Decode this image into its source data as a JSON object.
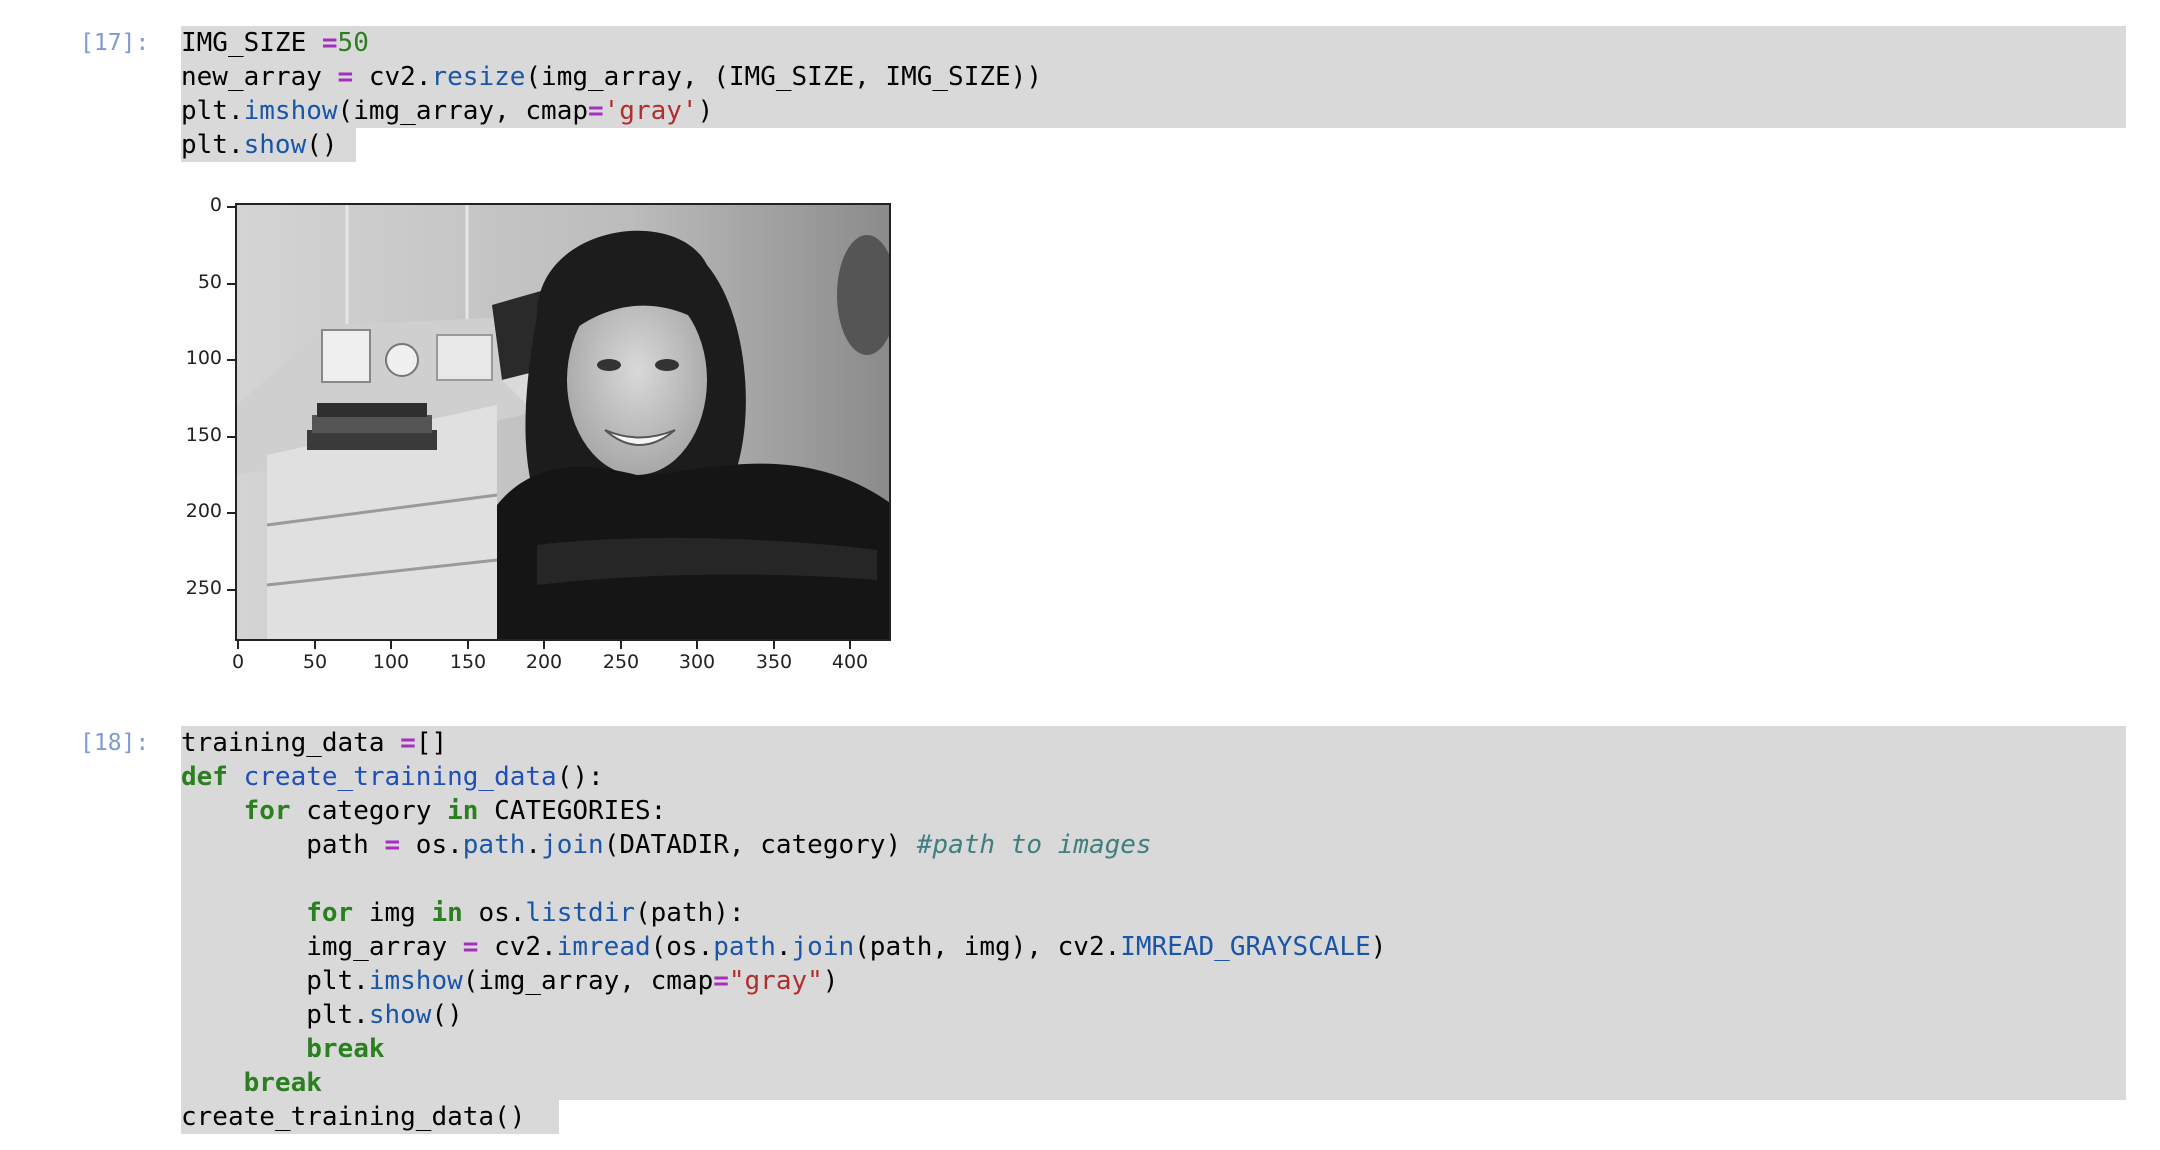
{
  "cells": [
    {
      "prompt": "[17]:",
      "lines": [
        [
          {
            "t": "IMG_SIZE "
          },
          {
            "t": "=",
            "c": "op"
          },
          {
            "t": "50",
            "c": "num"
          }
        ],
        [
          {
            "t": "new_array "
          },
          {
            "t": "=",
            "c": "op"
          },
          {
            "t": " cv2."
          },
          {
            "t": "resize",
            "c": "attr"
          },
          {
            "t": "(img_array, (IMG_SIZE, IMG_SIZE))"
          }
        ],
        [
          {
            "t": "plt."
          },
          {
            "t": "imshow",
            "c": "attr"
          },
          {
            "t": "(img_array, cmap"
          },
          {
            "t": "=",
            "c": "op"
          },
          {
            "t": "'gray'",
            "c": "str"
          },
          {
            "t": ")"
          }
        ],
        [
          {
            "t": "plt."
          },
          {
            "t": "show",
            "c": "attr"
          },
          {
            "t": "()"
          }
        ]
      ]
    },
    {
      "prompt": "[18]:",
      "lines": [
        [
          {
            "t": "training_data "
          },
          {
            "t": "=",
            "c": "op"
          },
          {
            "t": "[]"
          }
        ],
        [
          {
            "t": "def",
            "c": "kw"
          },
          {
            "t": " "
          },
          {
            "t": "create_training_data",
            "c": "fn"
          },
          {
            "t": "():"
          }
        ],
        [
          {
            "t": "    "
          },
          {
            "t": "for",
            "c": "kw"
          },
          {
            "t": " category "
          },
          {
            "t": "in",
            "c": "kw"
          },
          {
            "t": " CATEGORIES:"
          }
        ],
        [
          {
            "t": "        path "
          },
          {
            "t": "=",
            "c": "op"
          },
          {
            "t": " os."
          },
          {
            "t": "path",
            "c": "attr"
          },
          {
            "t": "."
          },
          {
            "t": "join",
            "c": "attr"
          },
          {
            "t": "(DATADIR, category) "
          },
          {
            "t": "#path to images",
            "c": "cm"
          }
        ],
        [
          {
            "t": ""
          }
        ],
        [
          {
            "t": "        "
          },
          {
            "t": "for",
            "c": "kw"
          },
          {
            "t": " img "
          },
          {
            "t": "in",
            "c": "kw"
          },
          {
            "t": " os."
          },
          {
            "t": "listdir",
            "c": "attr"
          },
          {
            "t": "(path):"
          }
        ],
        [
          {
            "t": "        img_array "
          },
          {
            "t": "=",
            "c": "op"
          },
          {
            "t": " cv2."
          },
          {
            "t": "imread",
            "c": "attr"
          },
          {
            "t": "(os."
          },
          {
            "t": "path",
            "c": "attr"
          },
          {
            "t": "."
          },
          {
            "t": "join",
            "c": "attr"
          },
          {
            "t": "(path, img), cv2."
          },
          {
            "t": "IMREAD_GRAYSCALE",
            "c": "attr"
          },
          {
            "t": ")"
          }
        ],
        [
          {
            "t": "        plt."
          },
          {
            "t": "imshow",
            "c": "attr"
          },
          {
            "t": "(img_array, cmap"
          },
          {
            "t": "=",
            "c": "op"
          },
          {
            "t": "\"gray\"",
            "c": "str"
          },
          {
            "t": ")"
          }
        ],
        [
          {
            "t": "        plt."
          },
          {
            "t": "show",
            "c": "attr"
          },
          {
            "t": "()"
          }
        ],
        [
          {
            "t": "        "
          },
          {
            "t": "break",
            "c": "kw"
          }
        ],
        [
          {
            "t": "    "
          },
          {
            "t": "break",
            "c": "kw"
          }
        ],
        [
          {
            "t": "create_training_data()"
          }
        ]
      ]
    }
  ],
  "output_plot": {
    "y_ticks": [
      "0",
      "50",
      "100",
      "150",
      "200",
      "250"
    ],
    "x_ticks": [
      "0",
      "50",
      "100",
      "150",
      "200",
      "250",
      "300",
      "350",
      "400"
    ]
  }
}
